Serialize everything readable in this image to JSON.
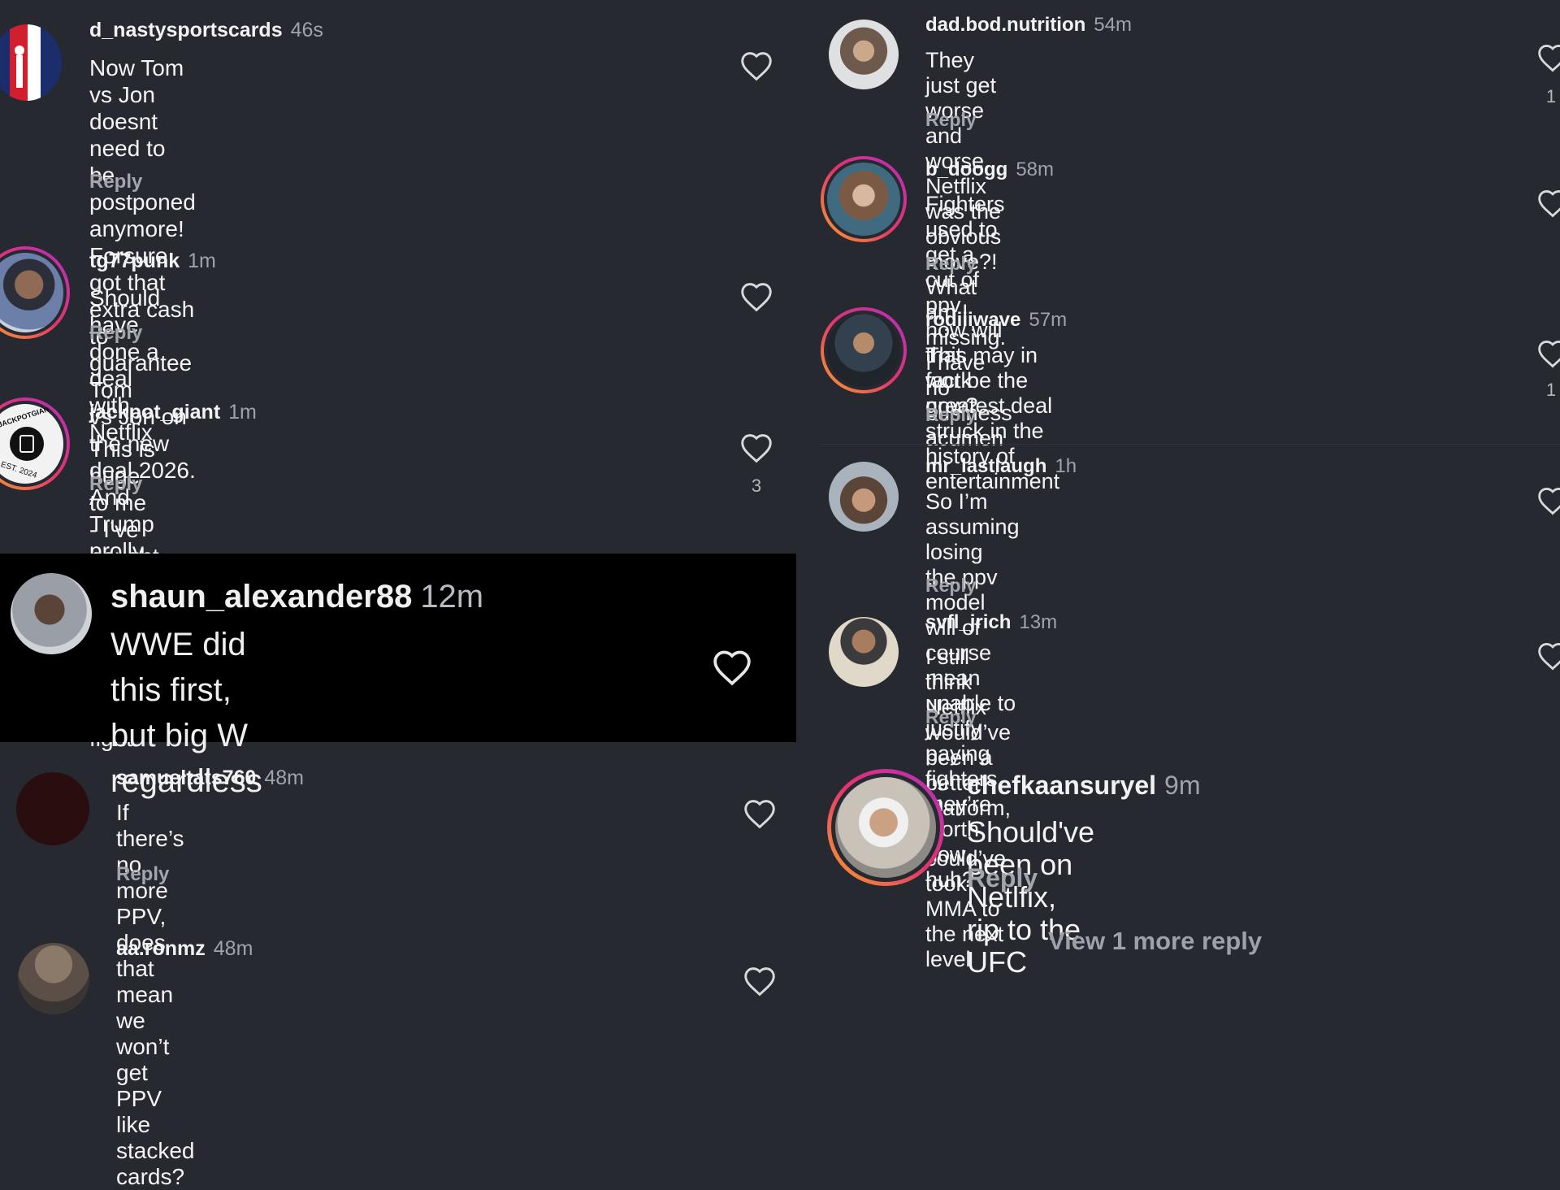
{
  "left": {
    "c1": {
      "username": "d_nastysportscards",
      "time": "46s",
      "text": "Now Tom vs Jon doesnt need to be postponed\nanymore! Forsure got that extra cash to guarantee Tom\nvs Jon on the new deal 2026. And Trump prolly boosted\nthe contract with the White House fight",
      "reply": "Reply"
    },
    "c2": {
      "username": "tg77punk",
      "time": "1m",
      "text": "Should have done a deal with Netflix",
      "reply": "Reply"
    },
    "c3": {
      "username": "jackpot_giant",
      "time": "1m",
      "text": "This is huge to me - I’ve bought every ppv since 2010",
      "reply": "Reply",
      "likes": "3",
      "avatar_text_top": "JACKPOTGIANT",
      "avatar_text_bottom": "EST. 2024"
    },
    "c4": {
      "username": "shaun_alexander88",
      "time": "12m",
      "text": "WWE did this first, but big W\nregardless"
    },
    "c5": {
      "username": "samueltats760",
      "time": "48m",
      "text": "If there’s no more PPV, does that mean we won’t get\nPPV like stacked cards?",
      "reply": "Reply"
    },
    "c6": {
      "username": "aa.ronmz",
      "time": "48m"
    }
  },
  "right": {
    "c1": {
      "username": "dad.bod.nutrition",
      "time": "54m",
      "text": "They just get worse and worse. Netflix was the obvious\nmove?! What am I missing. I have no business acumen",
      "reply": "Reply",
      "likes": "1"
    },
    "c2": {
      "username": "b_doogg",
      "time": "58m",
      "text": "Fighters used to get a cut of ppv how will that work\nnow?",
      "reply": "Reply"
    },
    "c3": {
      "username": "rodiiiwave",
      "time": "57m",
      "text": "This may in fact be the greatest deal struck in the\nhistory of entertainment",
      "reply": "Reply",
      "likes": "1"
    },
    "c4": {
      "username": "mr_lastlaugh",
      "time": "1h",
      "text": "So I’m assuming losing the ppv model will of course\nmean unable to justify paying fighters they’re worth\nnow huh?",
      "reply": "Reply"
    },
    "c5": {
      "username": "svfl_jrich",
      "time": "13m",
      "text": "I still think Netflix would’ve been a better platform, it\ncould’ve took MMA to the next level",
      "reply": "Reply"
    },
    "c6": {
      "username": "chefkaansuryel",
      "time": "9m",
      "text": "Should've been on Netlfix, rip to the UFC",
      "reply": "Reply"
    },
    "view_more": "View 1 more reply"
  },
  "colors": {
    "background": "#262930",
    "username": "#f2f2f4",
    "timestamp": "#a1a3ab",
    "reply": "#a4a6ad",
    "story_ring": [
      "#f9a22a",
      "#e3346d",
      "#b22ec5"
    ]
  },
  "icons": {
    "like": "heart-outline-icon"
  }
}
